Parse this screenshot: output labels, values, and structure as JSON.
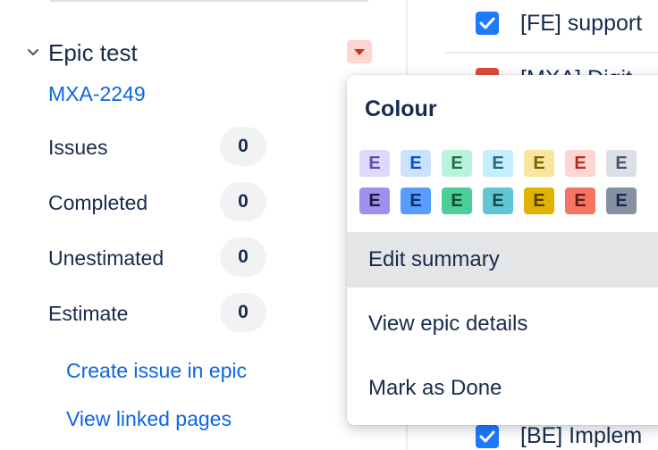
{
  "epic": {
    "name": "Epic test",
    "key": "MXA-2249",
    "stats": [
      {
        "label": "Issues",
        "value": "0"
      },
      {
        "label": "Completed",
        "value": "0"
      },
      {
        "label": "Unestimated",
        "value": "0"
      },
      {
        "label": "Estimate",
        "value": "0"
      }
    ],
    "links": {
      "create": "Create issue in epic",
      "view_pages": "View linked pages"
    }
  },
  "issues": {
    "top": "[FE] support",
    "middle": "[MXA] Digit",
    "bottom": "[BE] Implem"
  },
  "menu": {
    "heading": "Colour",
    "swatch_letter": "E",
    "swatch_colors_light": [
      {
        "bg": "#dfd8fd",
        "fg": "#5e4db2"
      },
      {
        "bg": "#cce0ff",
        "fg": "#0055cc"
      },
      {
        "bg": "#baf3db",
        "fg": "#216e4e"
      },
      {
        "bg": "#c6edfb",
        "fg": "#206a83"
      },
      {
        "bg": "#f8e6a0",
        "fg": "#7f5f01"
      },
      {
        "bg": "#ffd5d2",
        "fg": "#ae2e24"
      },
      {
        "bg": "#dcdfe4",
        "fg": "#44546f"
      }
    ],
    "swatch_colors_dark": [
      {
        "bg": "#9f8fef",
        "fg": "#1d1d3b"
      },
      {
        "bg": "#579dff",
        "fg": "#09326c"
      },
      {
        "bg": "#4bce97",
        "fg": "#164b35"
      },
      {
        "bg": "#60c6d2",
        "fg": "#1d474c"
      },
      {
        "bg": "#e2b203",
        "fg": "#533f04"
      },
      {
        "bg": "#f87462",
        "fg": "#5d1f1a"
      },
      {
        "bg": "#8590a2",
        "fg": "#172b4d"
      }
    ],
    "items": [
      {
        "label": "Edit summary"
      },
      {
        "label": "View epic details"
      },
      {
        "label": "Mark as Done"
      }
    ]
  }
}
